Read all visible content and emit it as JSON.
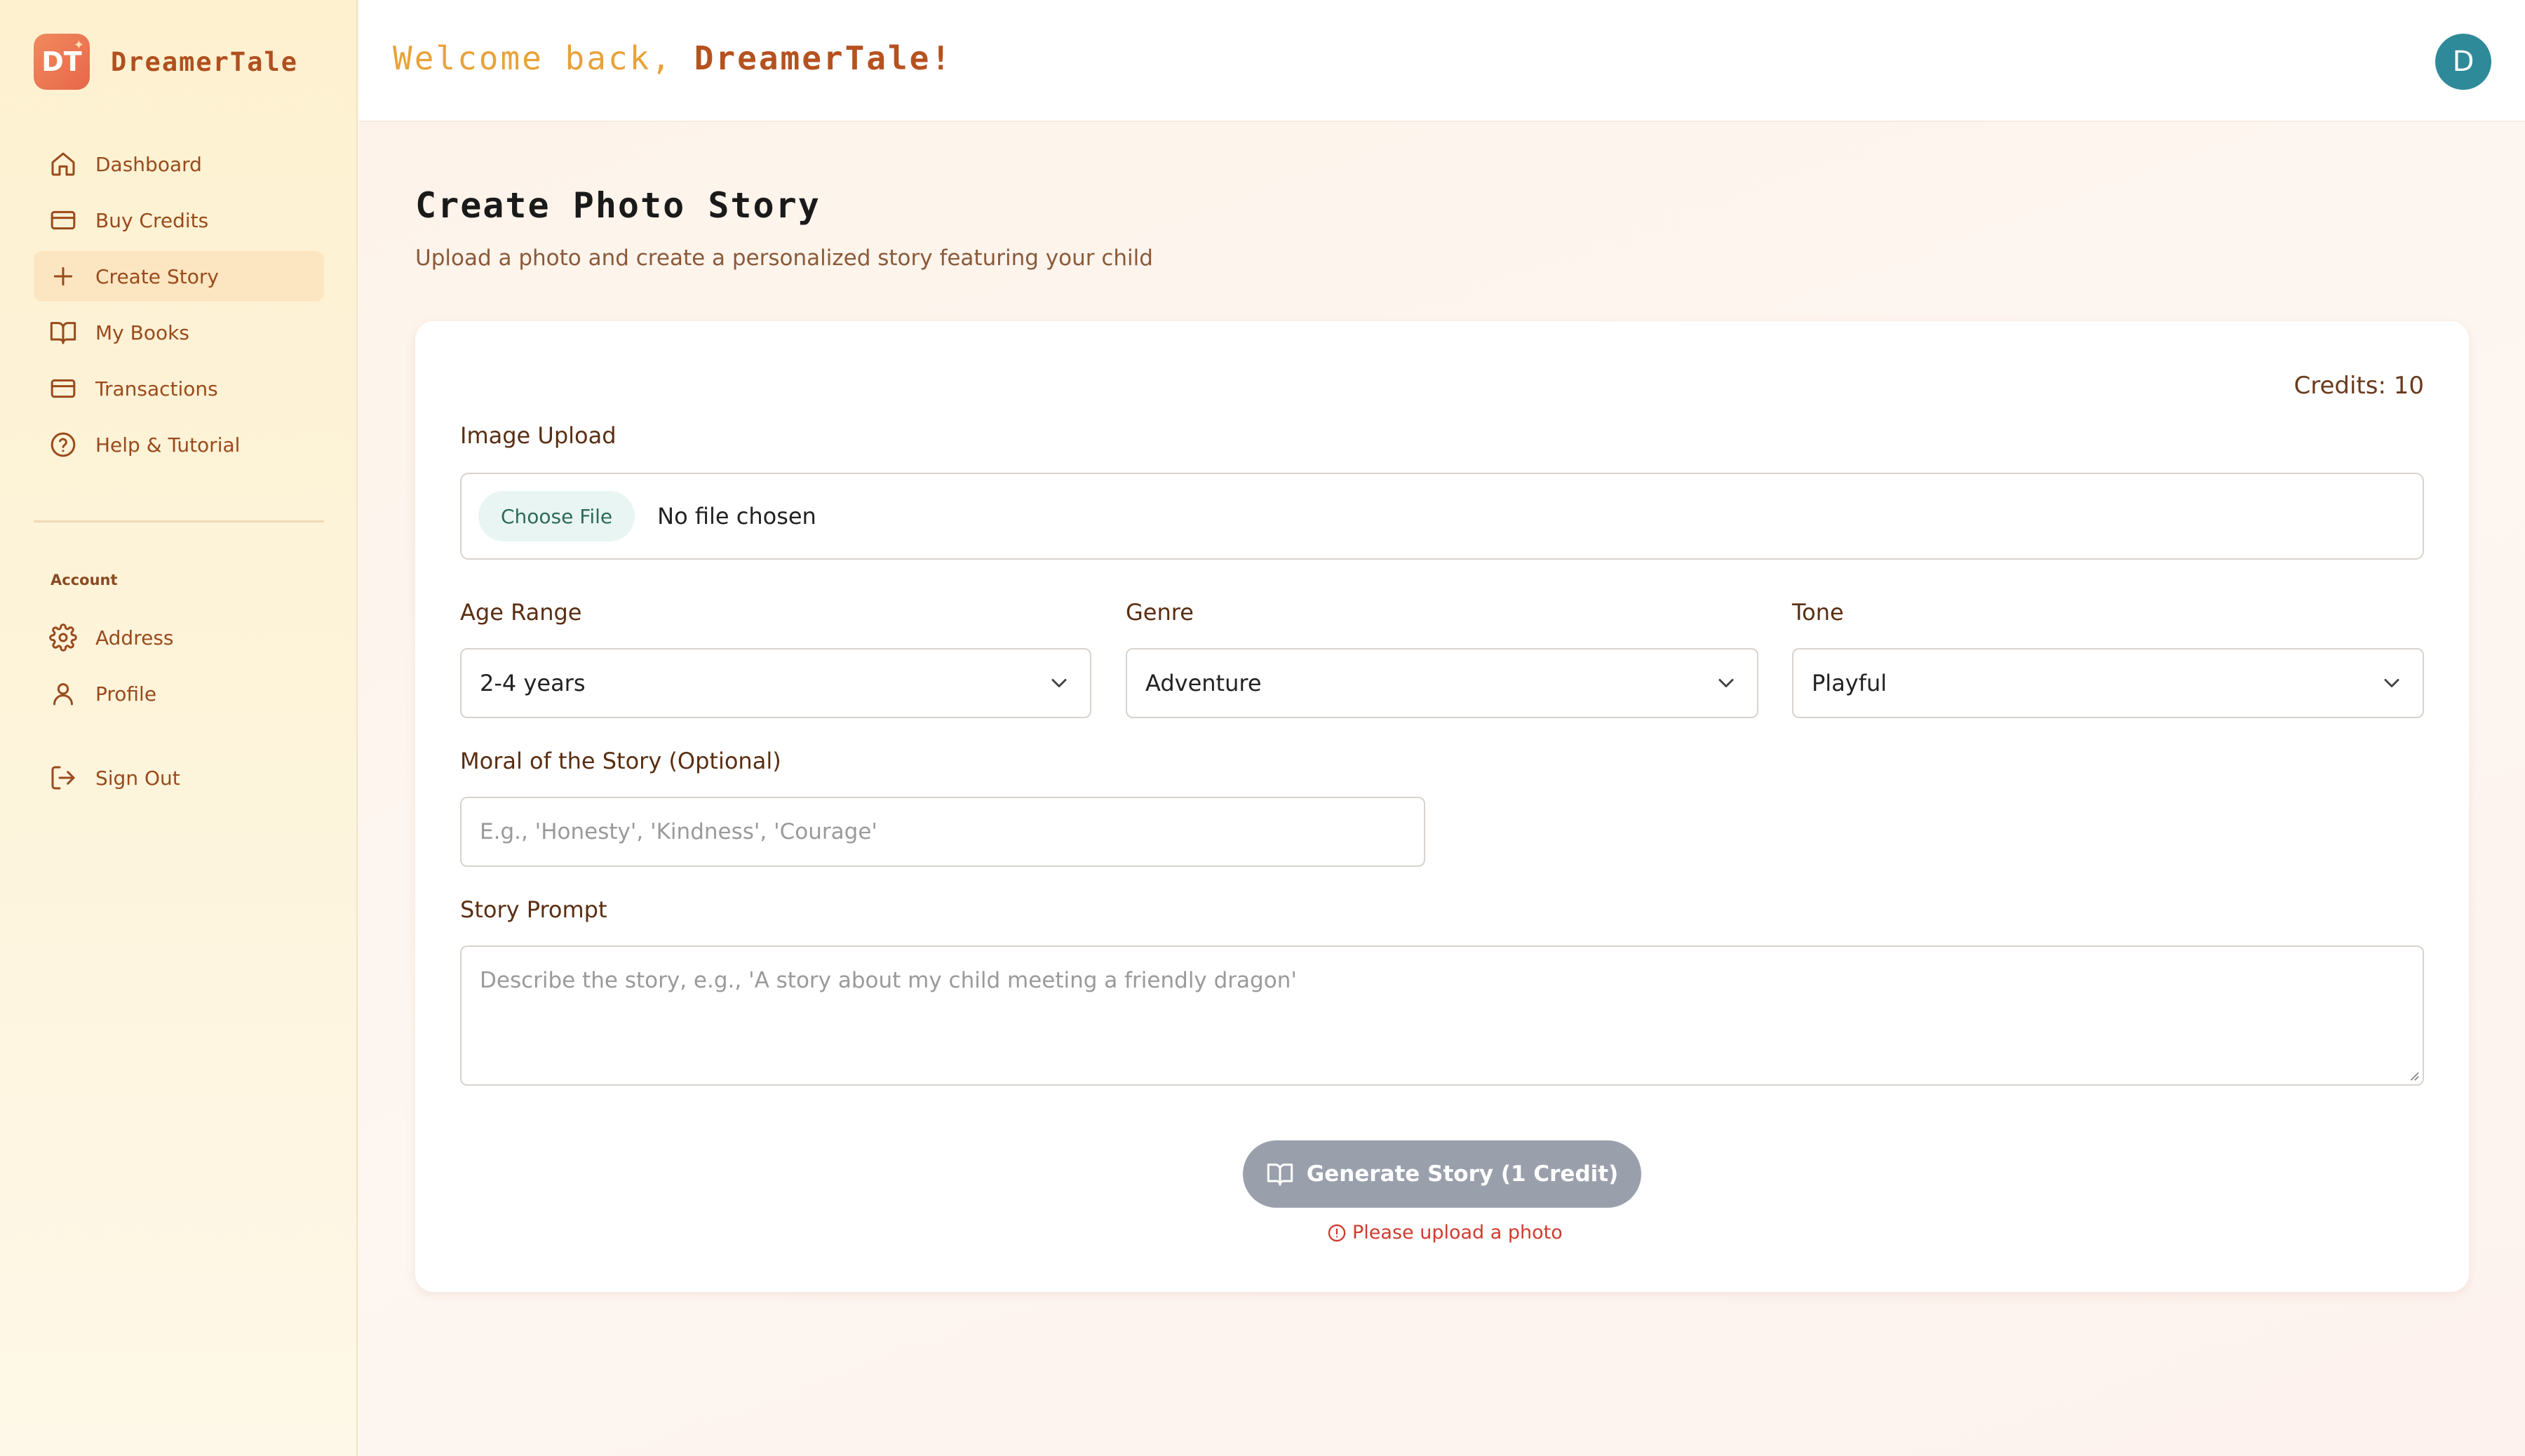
{
  "brand": {
    "logo_text": "DT",
    "name": "DreamerTale"
  },
  "header": {
    "welcome_prefix": "Welcome back,",
    "username": "DreamerTale!",
    "avatar_initial": "D"
  },
  "sidebar": {
    "items": [
      {
        "label": "Dashboard",
        "icon": "home-icon"
      },
      {
        "label": "Buy Credits",
        "icon": "credit-card-icon"
      },
      {
        "label": "Create Story",
        "icon": "plus-icon",
        "active": true
      },
      {
        "label": "My Books",
        "icon": "book-open-icon"
      },
      {
        "label": "Transactions",
        "icon": "credit-card-icon"
      },
      {
        "label": "Help & Tutorial",
        "icon": "help-circle-icon"
      }
    ],
    "account_label": "Account",
    "account_items": [
      {
        "label": "Address",
        "icon": "gear-icon"
      },
      {
        "label": "Profile",
        "icon": "user-icon"
      }
    ],
    "sign_out": {
      "label": "Sign Out",
      "icon": "log-out-icon"
    }
  },
  "page": {
    "title": "Create Photo Story",
    "subtitle": "Upload a photo and create a personalized story featuring your child"
  },
  "form": {
    "credits": "Credits: 10",
    "image_upload_label": "Image Upload",
    "choose_file": "Choose File",
    "file_status": "No file chosen",
    "age_range": {
      "label": "Age Range",
      "value": "2-4 years"
    },
    "genre": {
      "label": "Genre",
      "value": "Adventure"
    },
    "tone": {
      "label": "Tone",
      "value": "Playful"
    },
    "moral": {
      "label": "Moral of the Story (Optional)",
      "placeholder": "E.g., 'Honesty', 'Kindness', 'Courage'"
    },
    "prompt": {
      "label": "Story Prompt",
      "placeholder": "Describe the story, e.g., 'A story about my child meeting a friendly dragon'"
    },
    "generate_button": "Generate Story (1 Credit)",
    "error": "Please upload a photo"
  },
  "colors": {
    "accent": "#b0501f",
    "avatar": "#2e8a99",
    "error": "#d23a2e",
    "button_disabled": "#9aa0ab"
  }
}
